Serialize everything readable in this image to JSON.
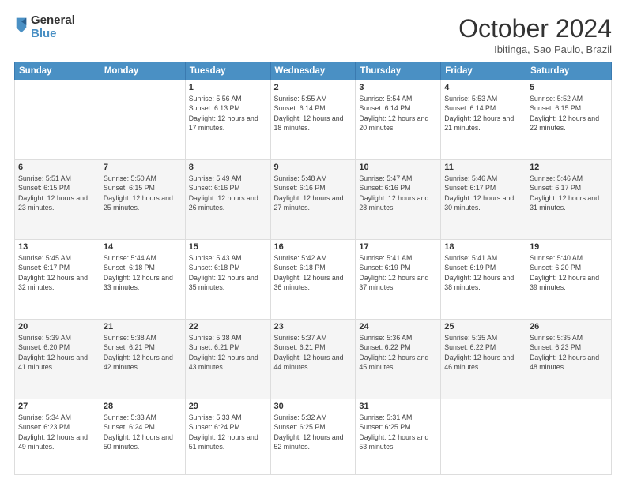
{
  "header": {
    "logo_line1": "General",
    "logo_line2": "Blue",
    "month": "October 2024",
    "location": "Ibitinga, Sao Paulo, Brazil"
  },
  "days_of_week": [
    "Sunday",
    "Monday",
    "Tuesday",
    "Wednesday",
    "Thursday",
    "Friday",
    "Saturday"
  ],
  "weeks": [
    [
      {
        "day": "",
        "info": ""
      },
      {
        "day": "",
        "info": ""
      },
      {
        "day": "1",
        "info": "Sunrise: 5:56 AM\nSunset: 6:13 PM\nDaylight: 12 hours and 17 minutes."
      },
      {
        "day": "2",
        "info": "Sunrise: 5:55 AM\nSunset: 6:14 PM\nDaylight: 12 hours and 18 minutes."
      },
      {
        "day": "3",
        "info": "Sunrise: 5:54 AM\nSunset: 6:14 PM\nDaylight: 12 hours and 20 minutes."
      },
      {
        "day": "4",
        "info": "Sunrise: 5:53 AM\nSunset: 6:14 PM\nDaylight: 12 hours and 21 minutes."
      },
      {
        "day": "5",
        "info": "Sunrise: 5:52 AM\nSunset: 6:15 PM\nDaylight: 12 hours and 22 minutes."
      }
    ],
    [
      {
        "day": "6",
        "info": "Sunrise: 5:51 AM\nSunset: 6:15 PM\nDaylight: 12 hours and 23 minutes."
      },
      {
        "day": "7",
        "info": "Sunrise: 5:50 AM\nSunset: 6:15 PM\nDaylight: 12 hours and 25 minutes."
      },
      {
        "day": "8",
        "info": "Sunrise: 5:49 AM\nSunset: 6:16 PM\nDaylight: 12 hours and 26 minutes."
      },
      {
        "day": "9",
        "info": "Sunrise: 5:48 AM\nSunset: 6:16 PM\nDaylight: 12 hours and 27 minutes."
      },
      {
        "day": "10",
        "info": "Sunrise: 5:47 AM\nSunset: 6:16 PM\nDaylight: 12 hours and 28 minutes."
      },
      {
        "day": "11",
        "info": "Sunrise: 5:46 AM\nSunset: 6:17 PM\nDaylight: 12 hours and 30 minutes."
      },
      {
        "day": "12",
        "info": "Sunrise: 5:46 AM\nSunset: 6:17 PM\nDaylight: 12 hours and 31 minutes."
      }
    ],
    [
      {
        "day": "13",
        "info": "Sunrise: 5:45 AM\nSunset: 6:17 PM\nDaylight: 12 hours and 32 minutes."
      },
      {
        "day": "14",
        "info": "Sunrise: 5:44 AM\nSunset: 6:18 PM\nDaylight: 12 hours and 33 minutes."
      },
      {
        "day": "15",
        "info": "Sunrise: 5:43 AM\nSunset: 6:18 PM\nDaylight: 12 hours and 35 minutes."
      },
      {
        "day": "16",
        "info": "Sunrise: 5:42 AM\nSunset: 6:18 PM\nDaylight: 12 hours and 36 minutes."
      },
      {
        "day": "17",
        "info": "Sunrise: 5:41 AM\nSunset: 6:19 PM\nDaylight: 12 hours and 37 minutes."
      },
      {
        "day": "18",
        "info": "Sunrise: 5:41 AM\nSunset: 6:19 PM\nDaylight: 12 hours and 38 minutes."
      },
      {
        "day": "19",
        "info": "Sunrise: 5:40 AM\nSunset: 6:20 PM\nDaylight: 12 hours and 39 minutes."
      }
    ],
    [
      {
        "day": "20",
        "info": "Sunrise: 5:39 AM\nSunset: 6:20 PM\nDaylight: 12 hours and 41 minutes."
      },
      {
        "day": "21",
        "info": "Sunrise: 5:38 AM\nSunset: 6:21 PM\nDaylight: 12 hours and 42 minutes."
      },
      {
        "day": "22",
        "info": "Sunrise: 5:38 AM\nSunset: 6:21 PM\nDaylight: 12 hours and 43 minutes."
      },
      {
        "day": "23",
        "info": "Sunrise: 5:37 AM\nSunset: 6:21 PM\nDaylight: 12 hours and 44 minutes."
      },
      {
        "day": "24",
        "info": "Sunrise: 5:36 AM\nSunset: 6:22 PM\nDaylight: 12 hours and 45 minutes."
      },
      {
        "day": "25",
        "info": "Sunrise: 5:35 AM\nSunset: 6:22 PM\nDaylight: 12 hours and 46 minutes."
      },
      {
        "day": "26",
        "info": "Sunrise: 5:35 AM\nSunset: 6:23 PM\nDaylight: 12 hours and 48 minutes."
      }
    ],
    [
      {
        "day": "27",
        "info": "Sunrise: 5:34 AM\nSunset: 6:23 PM\nDaylight: 12 hours and 49 minutes."
      },
      {
        "day": "28",
        "info": "Sunrise: 5:33 AM\nSunset: 6:24 PM\nDaylight: 12 hours and 50 minutes."
      },
      {
        "day": "29",
        "info": "Sunrise: 5:33 AM\nSunset: 6:24 PM\nDaylight: 12 hours and 51 minutes."
      },
      {
        "day": "30",
        "info": "Sunrise: 5:32 AM\nSunset: 6:25 PM\nDaylight: 12 hours and 52 minutes."
      },
      {
        "day": "31",
        "info": "Sunrise: 5:31 AM\nSunset: 6:25 PM\nDaylight: 12 hours and 53 minutes."
      },
      {
        "day": "",
        "info": ""
      },
      {
        "day": "",
        "info": ""
      }
    ]
  ]
}
